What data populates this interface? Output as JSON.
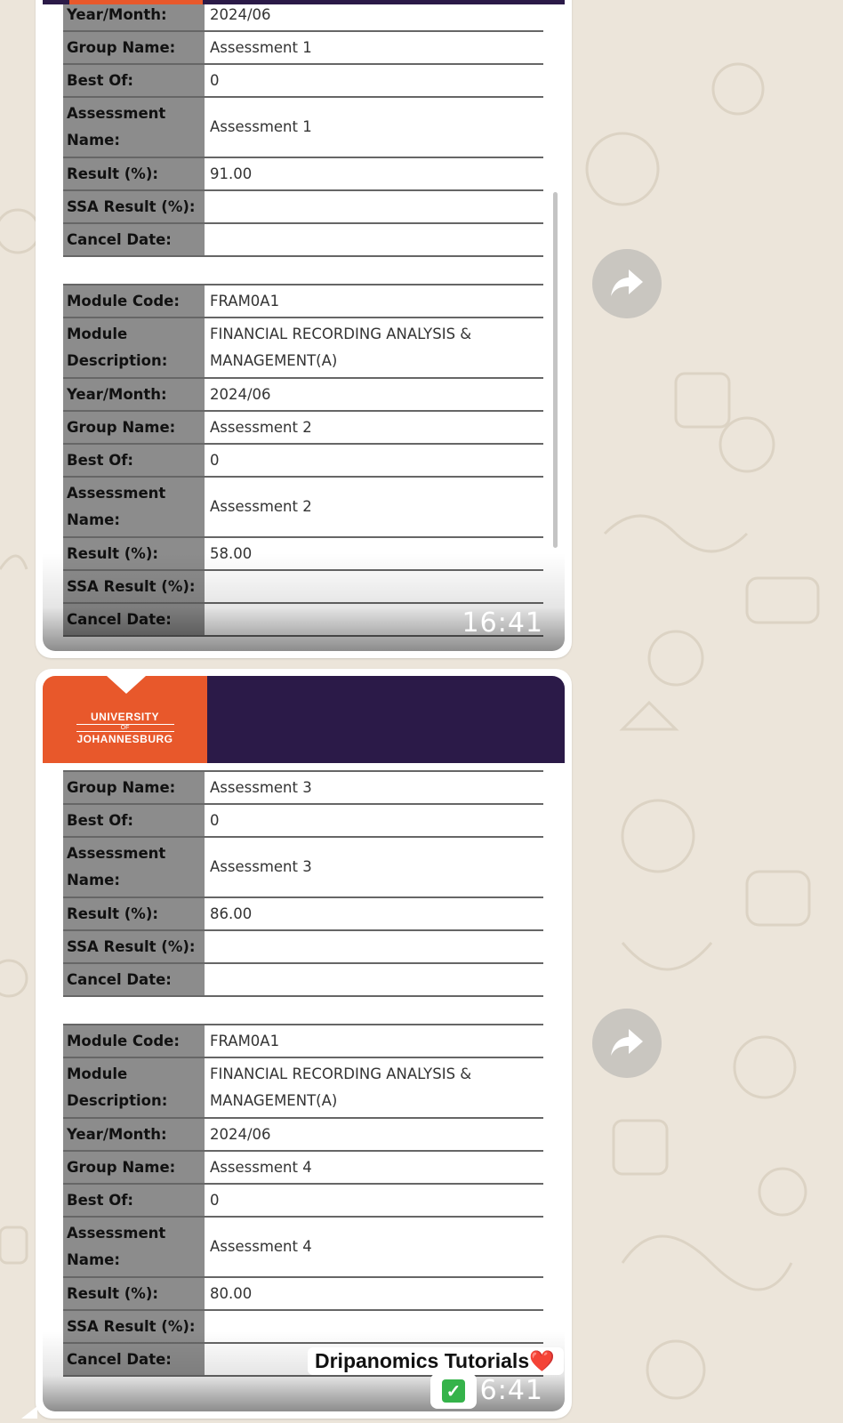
{
  "university": {
    "line1": "UNIVERSITY",
    "line2": "OF",
    "line3": "JOHANNESBURG"
  },
  "labels": {
    "module_code": "Module Code:",
    "module_description": "Module Description:",
    "year_month": "Year/Month:",
    "group_name": "Group Name:",
    "best_of": "Best Of:",
    "assessment_name": "Assessment Name:",
    "result": "Result (%):",
    "ssa_result": "SSA Result (%):",
    "cancel_date": "Cancel Date:"
  },
  "messages": [
    {
      "time": "16:41",
      "records": [
        {
          "year_month": "2024/06",
          "group_name": "Assessment 1",
          "best_of": "0",
          "assessment_name": "Assessment 1",
          "result": "91.00",
          "ssa_result": "",
          "cancel_date": ""
        },
        {
          "module_code": "FRAM0A1",
          "module_description": "FINANCIAL RECORDING ANALYSIS & MANAGEMENT(A)",
          "year_month": "2024/06",
          "group_name": "Assessment 2",
          "best_of": "0",
          "assessment_name": "Assessment 2",
          "result": "58.00",
          "ssa_result": "",
          "cancel_date": ""
        }
      ]
    },
    {
      "time": "16:41",
      "records": [
        {
          "group_name": "Assessment 3",
          "best_of": "0",
          "assessment_name": "Assessment 3",
          "result": "86.00",
          "ssa_result": "",
          "cancel_date": ""
        },
        {
          "module_code": "FRAM0A1",
          "module_description": "FINANCIAL RECORDING ANALYSIS & MANAGEMENT(A)",
          "year_month": "2024/06",
          "group_name": "Assessment 4",
          "best_of": "0",
          "assessment_name": "Assessment 4",
          "result": "80.00",
          "ssa_result": "",
          "cancel_date": ""
        }
      ]
    }
  ],
  "caption": {
    "text": "Dripanomics Tutorials",
    "emoji_heart": "❤️",
    "emoji_check": "✓"
  },
  "icons": {
    "share": "share-forward-icon",
    "check": "check-mark-icon",
    "heart": "heart-icon"
  },
  "colors": {
    "uj_orange": "#e8582b",
    "uj_purple": "#2b1a48",
    "label_gray": "#8c8c8c",
    "chat_bg": "#ece5da"
  }
}
